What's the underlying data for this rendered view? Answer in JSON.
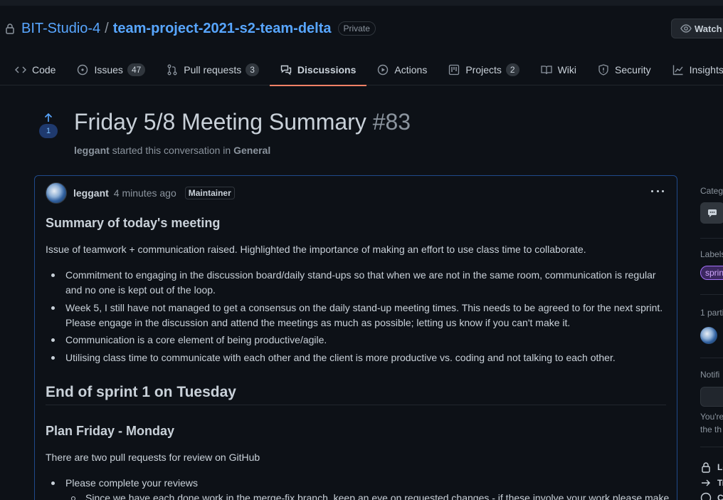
{
  "repo": {
    "owner": "BIT-Studio-4",
    "separator": "/",
    "name": "team-project-2021-s2-team-delta",
    "visibility": "Private",
    "watch_label": "Watch"
  },
  "tabs": [
    {
      "label": "Code",
      "count": null
    },
    {
      "label": "Issues",
      "count": "47"
    },
    {
      "label": "Pull requests",
      "count": "3"
    },
    {
      "label": "Discussions",
      "count": null
    },
    {
      "label": "Actions",
      "count": null
    },
    {
      "label": "Projects",
      "count": "2"
    },
    {
      "label": "Wiki",
      "count": null
    },
    {
      "label": "Security",
      "count": null
    },
    {
      "label": "Insights",
      "count": null
    }
  ],
  "discussion": {
    "upvotes": "1",
    "title": "Friday 5/8 Meeting Summary",
    "number": "#83",
    "starter": "leggant",
    "byline_middle": "started this conversation in",
    "category": "General"
  },
  "post": {
    "author": "leggant",
    "time": "4 minutes ago",
    "role": "Maintainer",
    "heading1": "Summary of today's meeting",
    "intro": "Issue of teamwork + communication raised. Highlighted the importance of making an effort to use class time to collaborate.",
    "bullets": [
      "Commitment to engaging in the discussion board/daily stand-ups so that when we are not in the same room, communication is regular and no one is kept out of the loop.",
      "Week 5, I still have not managed to get a consensus on the daily stand-up meeting times. This needs to be agreed to for the next sprint. Please engage in the discussion and attend the meetings as much as possible; letting us know if you can't make it.",
      "Communication is a core element of being productive/agile.",
      "Utilising class time to communicate with each other and the client is more productive vs. coding and not talking to each other."
    ],
    "heading2": "End of sprint 1 on Tuesday",
    "heading3": "Plan Friday - Monday",
    "pr_text": "There are two pull requests for review on GitHub",
    "bullet2": "Please complete your reviews",
    "subbullet": "Since we have each done work in the merge-fix branch, keep an eye on requested changes - if these involve your work please make"
  },
  "sidebar": {
    "category_label": "Categ",
    "labels_label": "Labels",
    "label_chip": "sprin",
    "participants_label": "1 parti",
    "notifications_label": "Notifi",
    "notif_text_1": "You're",
    "notif_text_2": "the th",
    "lock_label": "Lo",
    "transfer_label": "Tr",
    "other_label": "C"
  },
  "colors": {
    "link": "#58a6ff",
    "active_tab_underline": "#f78166",
    "post_border": "#1f4a8a",
    "label_chip": "#a371f7"
  }
}
